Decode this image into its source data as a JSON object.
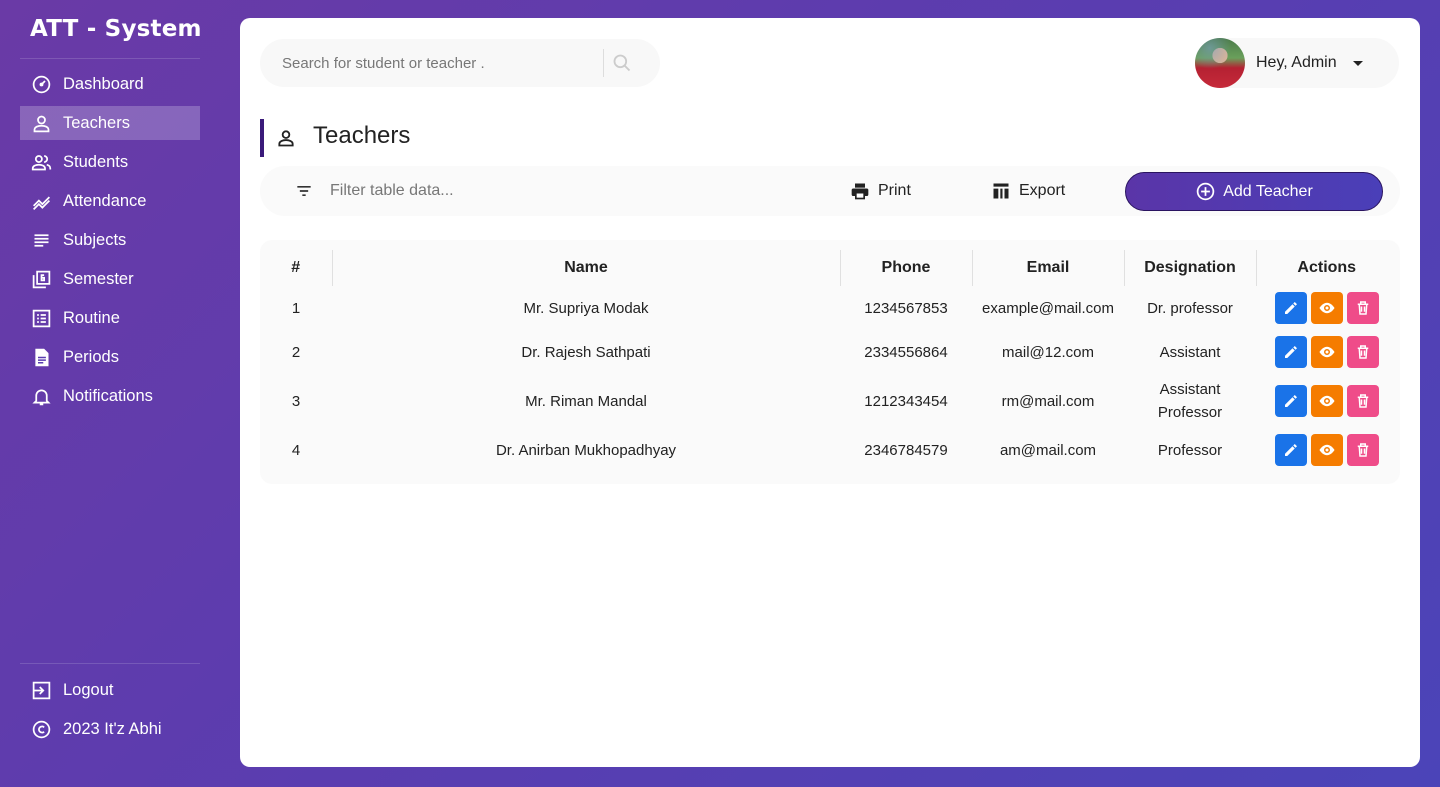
{
  "app": {
    "brand": "ATT - System"
  },
  "sidebar": {
    "items": [
      {
        "label": "Dashboard",
        "icon": "speedometer-icon"
      },
      {
        "label": "Teachers",
        "icon": "person-icon",
        "active": true
      },
      {
        "label": "Students",
        "icon": "people-icon"
      },
      {
        "label": "Attendance",
        "icon": "trending-icon"
      },
      {
        "label": "Subjects",
        "icon": "subject-lines-icon"
      },
      {
        "label": "Semester",
        "icon": "library-6-icon"
      },
      {
        "label": "Routine",
        "icon": "list-box-icon"
      },
      {
        "label": "Periods",
        "icon": "document-icon"
      },
      {
        "label": "Notifications",
        "icon": "bell-icon"
      }
    ],
    "bottom": [
      {
        "label": "Logout",
        "icon": "logout-icon"
      },
      {
        "label": "2023 It'z Abhi",
        "icon": "copyright-icon"
      }
    ]
  },
  "header": {
    "search_placeholder": "Search for student or teacher .",
    "user_greeting": "Hey, Admin"
  },
  "page": {
    "title": "Teachers"
  },
  "toolbar": {
    "filter_placeholder": "Filter table data...",
    "print_label": "Print",
    "export_label": "Export",
    "add_label": "Add Teacher"
  },
  "table": {
    "columns": [
      "#",
      "Name",
      "Phone",
      "Email",
      "Designation",
      "Actions"
    ],
    "rows": [
      {
        "num": "1",
        "name": "Mr. Supriya Modak",
        "phone": "1234567853",
        "email": "example@mail.com",
        "designation": "Dr. professor"
      },
      {
        "num": "2",
        "name": "Dr. Rajesh Sathpati",
        "phone": "2334556864",
        "email": "mail@12.com",
        "designation": "Assistant"
      },
      {
        "num": "3",
        "name": "Mr. Riman Mandal",
        "phone": "1212343454",
        "email": "rm@mail.com",
        "designation": "Assistant Professor"
      },
      {
        "num": "4",
        "name": "Dr. Anirban Mukhopadhyay",
        "phone": "2346784579",
        "email": "am@mail.com",
        "designation": "Professor"
      }
    ]
  },
  "colors": {
    "edit": "#1a73e8",
    "view": "#f57c00",
    "delete": "#ef4c89",
    "accent": "#3a1a7a"
  }
}
